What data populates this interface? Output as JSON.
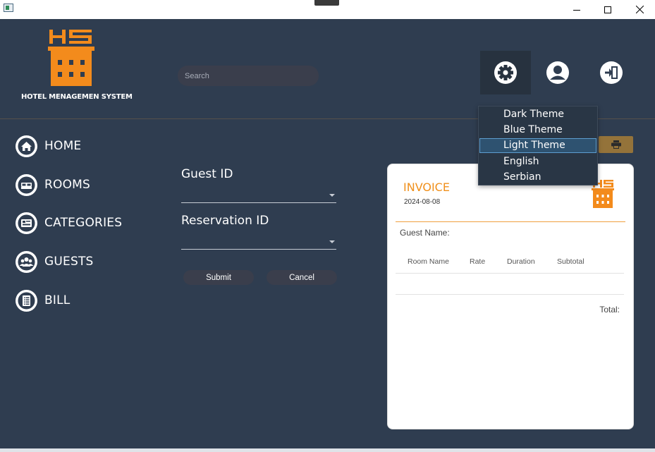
{
  "window": {
    "minimize_icon": "minimize-icon",
    "maximize_icon": "maximize-icon",
    "close_icon": "close-icon"
  },
  "header": {
    "logo_text": "HS",
    "app_name": "HOTEL MENAGEMEN SYSTEM",
    "search_placeholder": "Search",
    "settings_icon": "gear-icon",
    "profile_icon": "user-icon",
    "logout_icon": "logout-icon"
  },
  "settings_menu": {
    "items": [
      "Dark Theme",
      "Blue Theme",
      "Light Theme",
      "English",
      "Serbian"
    ],
    "highlighted": "Light Theme"
  },
  "sidebar": {
    "items": [
      {
        "label": "HOME",
        "icon": "home-icon"
      },
      {
        "label": "ROOMS",
        "icon": "bed-icon"
      },
      {
        "label": "CATEGORIES",
        "icon": "categories-icon"
      },
      {
        "label": "GUESTS",
        "icon": "guests-icon"
      },
      {
        "label": "BILL",
        "icon": "bill-icon"
      }
    ]
  },
  "form": {
    "guest_id_label": "Guest ID",
    "guest_id_value": "",
    "reservation_id_label": "Reservation ID",
    "reservation_id_value": "",
    "submit_label": "Submit",
    "cancel_label": "Cancel"
  },
  "print_icon": "printer-icon",
  "invoice": {
    "title": "INVOICE",
    "date": "2024-08-08",
    "logo_text": "HS",
    "guest_name_label": "Guest Name:",
    "columns": [
      "Room Name",
      "Rate",
      "Duration",
      "Subtotal"
    ],
    "rows": [],
    "total_label": "Total:"
  },
  "colors": {
    "background": "#2f3d50",
    "accent_orange": "#f38b1c",
    "menu_highlight": "#2e5270",
    "print_button": "#94733a"
  }
}
